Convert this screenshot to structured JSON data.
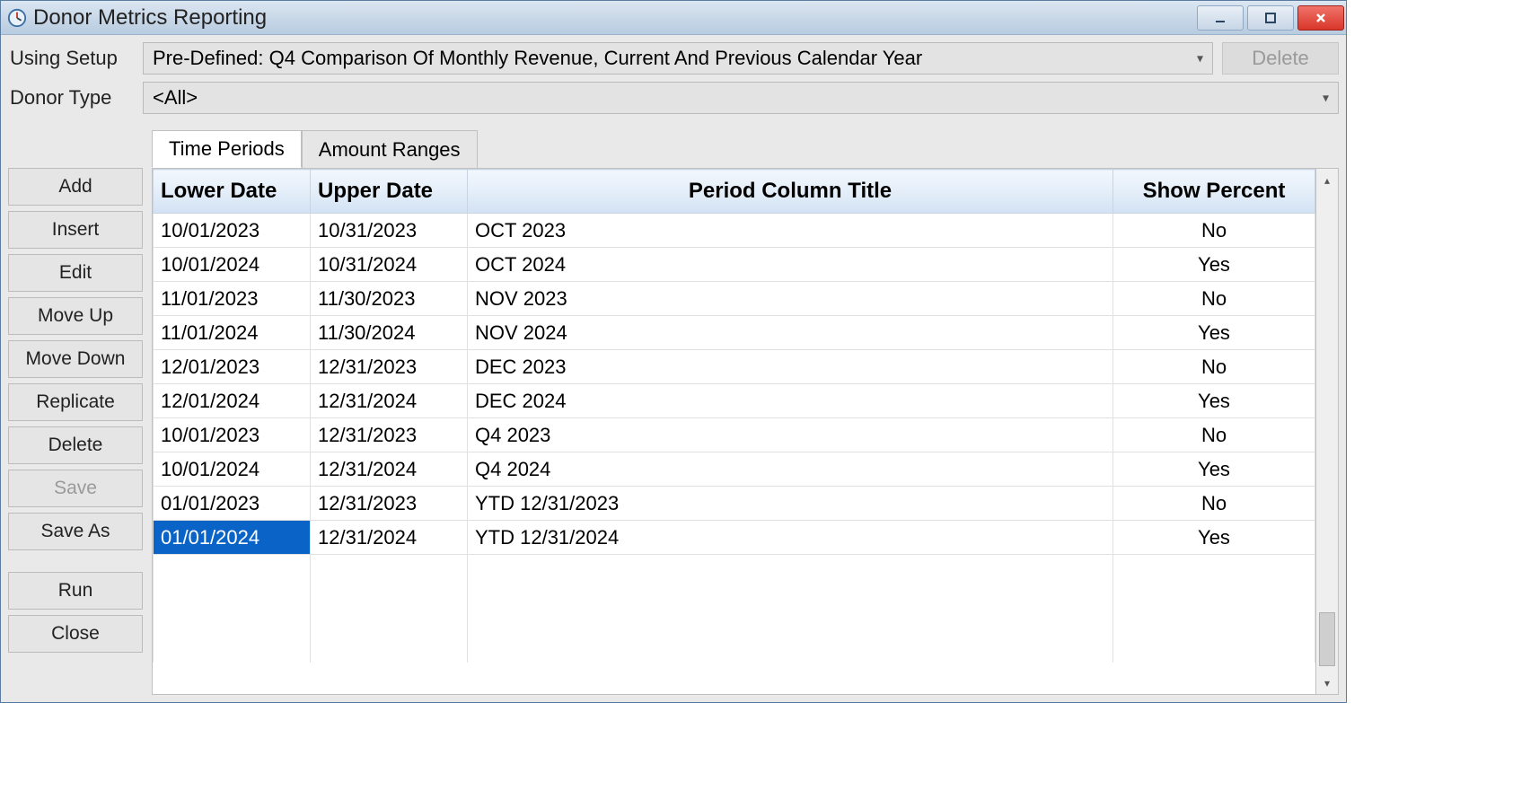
{
  "window": {
    "title": "Donor Metrics Reporting"
  },
  "form": {
    "using_setup_label": "Using Setup",
    "using_setup_value": "Pre-Defined: Q4 Comparison Of Monthly Revenue, Current And Previous Calendar Year",
    "donor_type_label": "Donor Type",
    "donor_type_value": "<All>",
    "delete_btn": "Delete"
  },
  "tabs": {
    "time_periods": "Time Periods",
    "amount_ranges": "Amount Ranges"
  },
  "side": {
    "add": "Add",
    "insert": "Insert",
    "edit": "Edit",
    "move_up": "Move Up",
    "move_down": "Move Down",
    "replicate": "Replicate",
    "delete": "Delete",
    "save": "Save",
    "save_as": "Save As",
    "run": "Run",
    "close": "Close"
  },
  "columns": {
    "lower": "Lower Date",
    "upper": "Upper Date",
    "title": "Period Column Title",
    "show": "Show Percent"
  },
  "rows": [
    {
      "lower": "10/01/2023",
      "upper": "10/31/2023",
      "title": "OCT 2023",
      "show": "No"
    },
    {
      "lower": "10/01/2024",
      "upper": "10/31/2024",
      "title": "OCT 2024",
      "show": "Yes"
    },
    {
      "lower": "11/01/2023",
      "upper": "11/30/2023",
      "title": "NOV 2023",
      "show": "No"
    },
    {
      "lower": "11/01/2024",
      "upper": "11/30/2024",
      "title": "NOV 2024",
      "show": "Yes"
    },
    {
      "lower": "12/01/2023",
      "upper": "12/31/2023",
      "title": "DEC 2023",
      "show": "No"
    },
    {
      "lower": "12/01/2024",
      "upper": "12/31/2024",
      "title": "DEC 2024",
      "show": "Yes"
    },
    {
      "lower": "10/01/2023",
      "upper": "12/31/2023",
      "title": "Q4 2023",
      "show": "No"
    },
    {
      "lower": "10/01/2024",
      "upper": "12/31/2024",
      "title": "Q4 2024",
      "show": "Yes"
    },
    {
      "lower": "01/01/2023",
      "upper": "12/31/2023",
      "title": "YTD 12/31/2023",
      "show": "No"
    },
    {
      "lower": "01/01/2024",
      "upper": "12/31/2024",
      "title": "YTD 12/31/2024",
      "show": "Yes"
    }
  ],
  "selected_row_index": 9,
  "selected_col": "lower"
}
